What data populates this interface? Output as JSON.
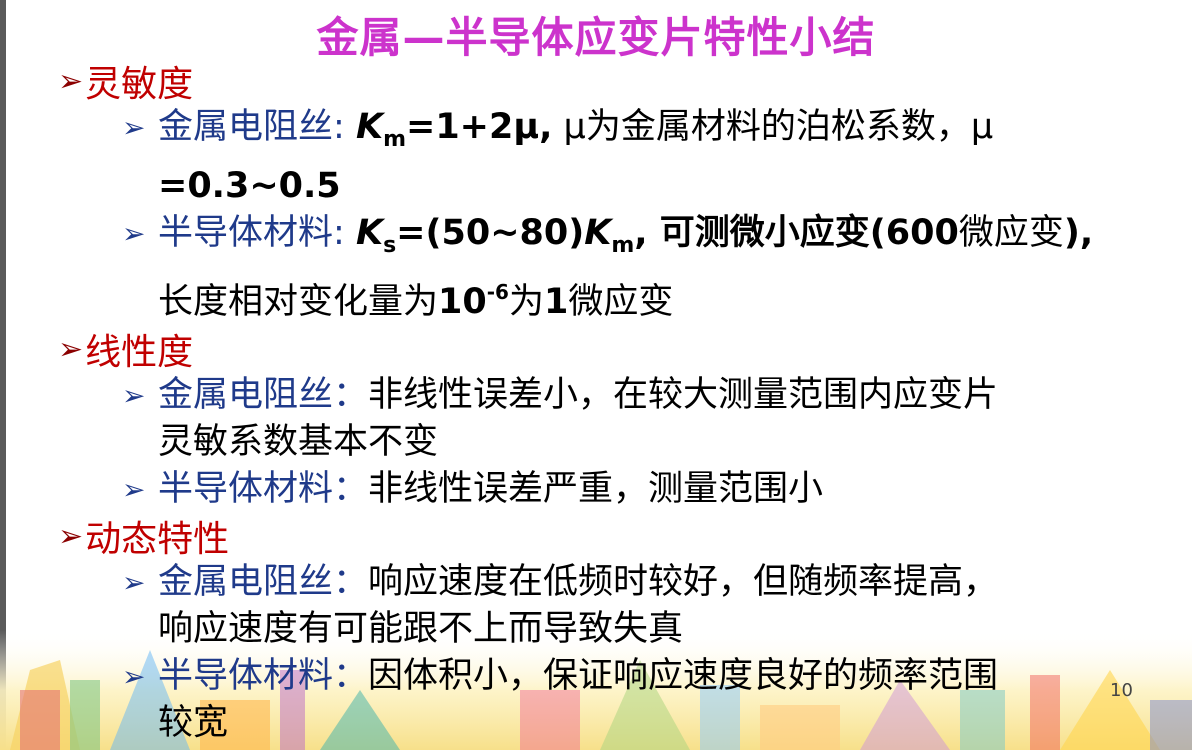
{
  "title": "金属—半导体应变片特性小结",
  "sections": [
    {
      "label": "灵敏度",
      "items": [
        {
          "lead": "金属电阻丝:",
          "k": "K",
          "k_sub": "m",
          "formula": "=1+2μ,",
          "rest": " μ为金属材料的泊松系数，μ",
          "line2": "=0.3~0.5"
        },
        {
          "lead": "半导体材料:",
          "k": "K",
          "k_sub": "s",
          "formula": "=(50~80)",
          "k2": "K",
          "k2_sub": "m",
          "rest_a": ", 可测微小应变",
          "rest_b": "(600",
          "rest_c": "微应变",
          "rest_d": "),",
          "line2_a": "长度相对变化量为",
          "line2_b": "10",
          "line2_sup": "-6",
          "line2_c": "为",
          "line2_d": "1",
          "line2_e": "微应变"
        }
      ]
    },
    {
      "label": "线性度",
      "items": [
        {
          "lead": "金属电阻丝：",
          "text": "非线性误差小，在较大测量范围内应变片",
          "line2": "灵敏系数基本不变"
        },
        {
          "lead": "半导体材料：",
          "text": "非线性误差严重，测量范围小"
        }
      ]
    },
    {
      "label": "动态特性",
      "items": [
        {
          "lead": "金属电阻丝：",
          "text": "响应速度在低频时较好，但随频率提高，",
          "line2": "响应速度有可能跟不上而导致失真"
        },
        {
          "lead": "半导体材料：",
          "text": "因体积小，保证响应速度良好的频率范围",
          "line2": "较宽"
        }
      ]
    }
  ],
  "page_number": "10",
  "colors": {
    "title": "#cc33cc",
    "section_label": "#c00000",
    "lead": "#1f3a8a"
  }
}
